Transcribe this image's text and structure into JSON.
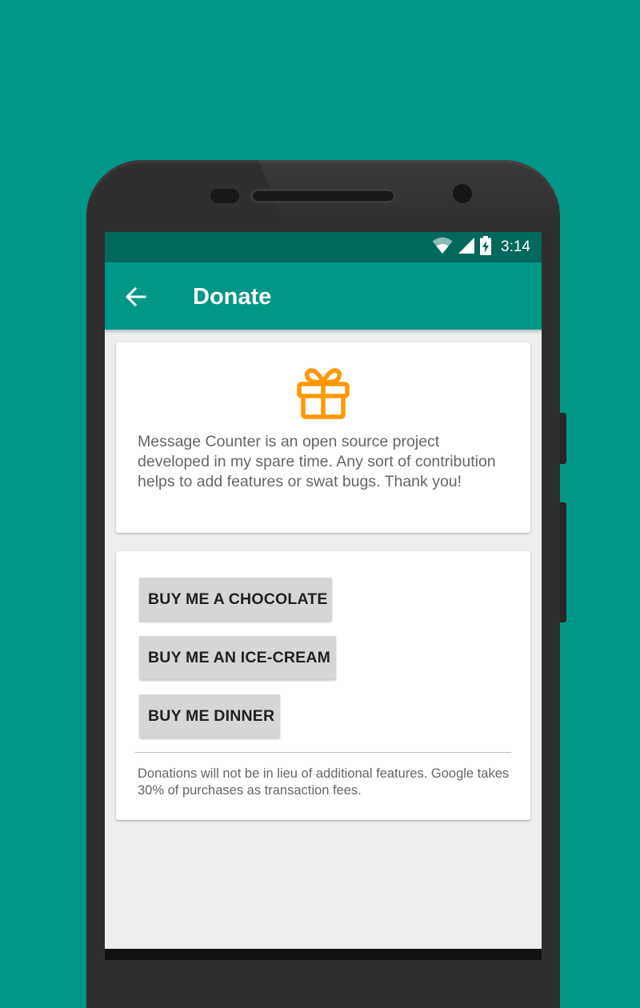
{
  "status_bar": {
    "time": "3:14",
    "icons": [
      "wifi-icon",
      "signal-icon",
      "battery-charging-icon"
    ]
  },
  "toolbar": {
    "back_icon": "arrow-back-icon",
    "title": "Donate"
  },
  "intro_card": {
    "icon": "gift-icon",
    "icon_color": "#FF9800",
    "text": "Message Counter is an open source project developed in my spare time. Any sort of contribution helps to add features or swat bugs. Thank you!"
  },
  "donate_card": {
    "buttons": [
      {
        "label": "BUY ME A CHOCOLATE"
      },
      {
        "label": "BUY ME AN ICE-CREAM"
      },
      {
        "label": "BUY ME DINNER"
      }
    ],
    "footer": "Donations will not be in lieu of additional features. Google takes 30% of purchases as transaction fees."
  },
  "colors": {
    "background": "#009688",
    "primary": "#009688",
    "primary_dark": "#00695C",
    "accent": "#FF9800"
  }
}
